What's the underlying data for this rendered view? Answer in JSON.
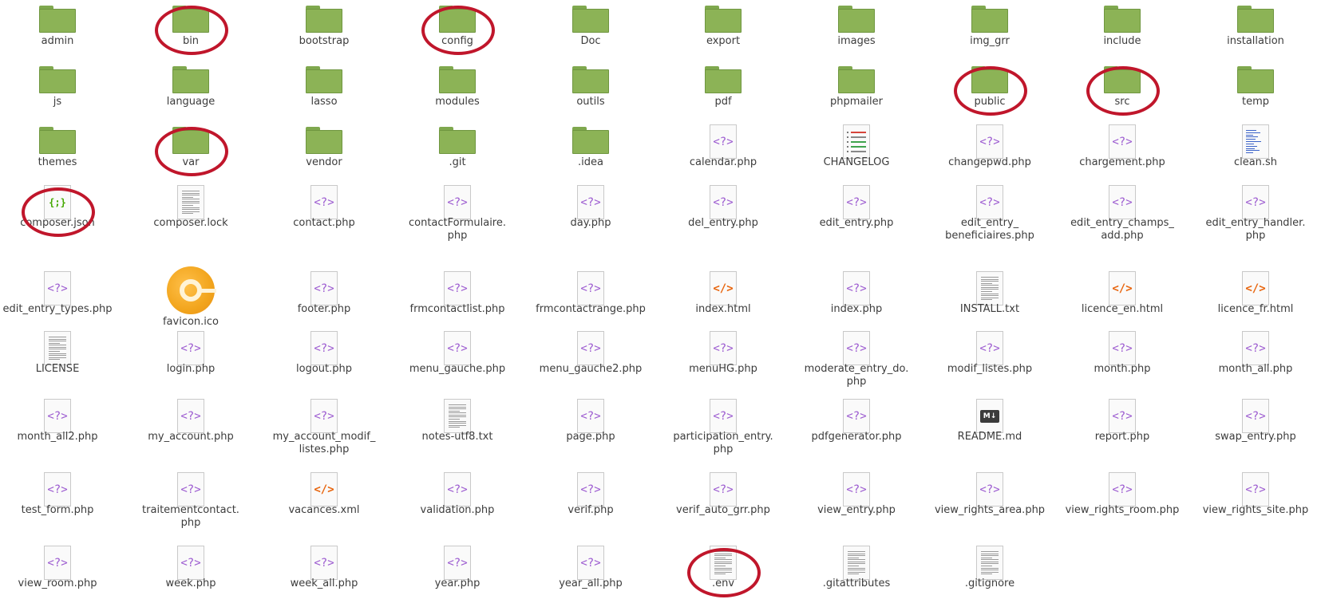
{
  "accent_colors": {
    "folder": "#8cb356",
    "highlight_circle": "#c0162b",
    "php_icon": "#9b59d0",
    "html_icon": "#e8650e"
  },
  "icon_glyphs": {
    "php": "<?>",
    "html": "</>",
    "json": "{;}",
    "md": "M↓"
  },
  "items": [
    {
      "name": "admin",
      "type": "folder"
    },
    {
      "name": "bin",
      "type": "folder",
      "circled": true
    },
    {
      "name": "bootstrap",
      "type": "folder"
    },
    {
      "name": "config",
      "type": "folder",
      "circled": true
    },
    {
      "name": "Doc",
      "type": "folder"
    },
    {
      "name": "export",
      "type": "folder"
    },
    {
      "name": "images",
      "type": "folder"
    },
    {
      "name": "img_grr",
      "type": "folder"
    },
    {
      "name": "include",
      "type": "folder"
    },
    {
      "name": "installation",
      "type": "folder"
    },
    {
      "name": "js",
      "type": "folder"
    },
    {
      "name": "language",
      "type": "folder"
    },
    {
      "name": "lasso",
      "type": "folder"
    },
    {
      "name": "modules",
      "type": "folder"
    },
    {
      "name": "outils",
      "type": "folder"
    },
    {
      "name": "pdf",
      "type": "folder"
    },
    {
      "name": "phpmailer",
      "type": "folder"
    },
    {
      "name": "public",
      "type": "folder",
      "circled": true
    },
    {
      "name": "src",
      "type": "folder",
      "circled": true
    },
    {
      "name": "temp",
      "type": "folder"
    },
    {
      "name": "themes",
      "type": "folder"
    },
    {
      "name": "var",
      "type": "folder",
      "circled": true
    },
    {
      "name": "vendor",
      "type": "folder"
    },
    {
      "name": ".git",
      "type": "folder"
    },
    {
      "name": ".idea",
      "type": "folder"
    },
    {
      "name": "calendar.php",
      "type": "php"
    },
    {
      "name": "CHANGELOG",
      "type": "changelog"
    },
    {
      "name": "changepwd.php",
      "type": "php"
    },
    {
      "name": "chargement.php",
      "type": "php"
    },
    {
      "name": "clean.sh",
      "type": "script"
    },
    {
      "name": "composer.json",
      "type": "json",
      "circled": true
    },
    {
      "name": "composer.lock",
      "type": "text"
    },
    {
      "name": "contact.php",
      "type": "php"
    },
    {
      "name": "contactFormulaire.\nphp",
      "type": "php"
    },
    {
      "name": "day.php",
      "type": "php"
    },
    {
      "name": "del_entry.php",
      "type": "php"
    },
    {
      "name": "edit_entry.php",
      "type": "php"
    },
    {
      "name": "edit_entry_\nbeneficiaires.php",
      "type": "php"
    },
    {
      "name": "edit_entry_champs_\nadd.php",
      "type": "php"
    },
    {
      "name": "edit_entry_handler.\nphp",
      "type": "php"
    },
    {
      "name": "edit_entry_types.php",
      "type": "php"
    },
    {
      "name": "favicon.ico",
      "type": "ico"
    },
    {
      "name": "footer.php",
      "type": "php"
    },
    {
      "name": "frmcontactlist.php",
      "type": "php"
    },
    {
      "name": "frmcontactrange.php",
      "type": "php"
    },
    {
      "name": "index.html",
      "type": "html"
    },
    {
      "name": "index.php",
      "type": "php"
    },
    {
      "name": "INSTALL.txt",
      "type": "text"
    },
    {
      "name": "licence_en.html",
      "type": "html"
    },
    {
      "name": "licence_fr.html",
      "type": "html"
    },
    {
      "name": "LICENSE",
      "type": "text"
    },
    {
      "name": "login.php",
      "type": "php"
    },
    {
      "name": "logout.php",
      "type": "php"
    },
    {
      "name": "menu_gauche.php",
      "type": "php"
    },
    {
      "name": "menu_gauche2.php",
      "type": "php"
    },
    {
      "name": "menuHG.php",
      "type": "php"
    },
    {
      "name": "moderate_entry_do.\nphp",
      "type": "php"
    },
    {
      "name": "modif_listes.php",
      "type": "php"
    },
    {
      "name": "month.php",
      "type": "php"
    },
    {
      "name": "month_all.php",
      "type": "php"
    },
    {
      "name": "month_all2.php",
      "type": "php"
    },
    {
      "name": "my_account.php",
      "type": "php"
    },
    {
      "name": "my_account_modif_\nlistes.php",
      "type": "php"
    },
    {
      "name": "notes-utf8.txt",
      "type": "text"
    },
    {
      "name": "page.php",
      "type": "php"
    },
    {
      "name": "participation_entry.\nphp",
      "type": "php"
    },
    {
      "name": "pdfgenerator.php",
      "type": "php"
    },
    {
      "name": "README.md",
      "type": "md"
    },
    {
      "name": "report.php",
      "type": "php"
    },
    {
      "name": "swap_entry.php",
      "type": "php"
    },
    {
      "name": "test_form.php",
      "type": "php"
    },
    {
      "name": "traitementcontact.\nphp",
      "type": "php"
    },
    {
      "name": "vacances.xml",
      "type": "html"
    },
    {
      "name": "validation.php",
      "type": "php"
    },
    {
      "name": "verif.php",
      "type": "php"
    },
    {
      "name": "verif_auto_grr.php",
      "type": "php"
    },
    {
      "name": "view_entry.php",
      "type": "php"
    },
    {
      "name": "view_rights_area.php",
      "type": "php"
    },
    {
      "name": "view_rights_room.php",
      "type": "php"
    },
    {
      "name": "view_rights_site.php",
      "type": "php"
    },
    {
      "name": "view_room.php",
      "type": "php"
    },
    {
      "name": "week.php",
      "type": "php"
    },
    {
      "name": "week_all.php",
      "type": "php"
    },
    {
      "name": "year.php",
      "type": "php"
    },
    {
      "name": "year_all.php",
      "type": "php"
    },
    {
      "name": ".env",
      "type": "text",
      "circled": true
    },
    {
      "name": ".gitattributes",
      "type": "text"
    },
    {
      "name": ".gitignore",
      "type": "text"
    }
  ]
}
